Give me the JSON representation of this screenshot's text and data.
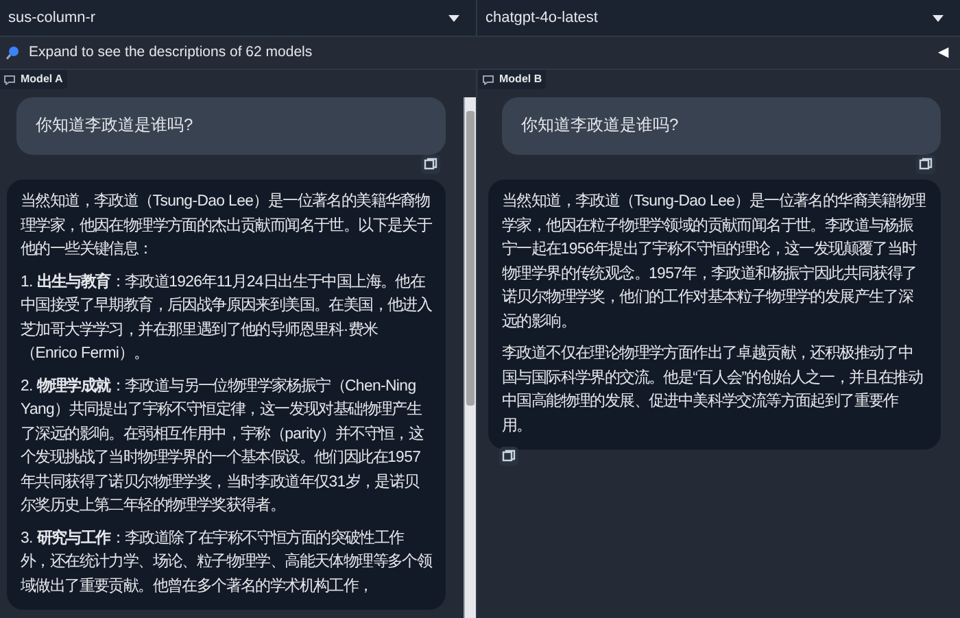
{
  "model_selectors": [
    {
      "value": "sus-column-r"
    },
    {
      "value": "chatgpt-4o-latest"
    }
  ],
  "expand_bar": {
    "label": "Expand to see the descriptions of 62 models",
    "toggle": "◀"
  },
  "panels": [
    {
      "label": "Model A",
      "question": "你知道李政道是谁吗?",
      "answer": [
        "当然知道，李政道（Tsung-Dao Lee）是一位著名的美籍华裔物理学家，他因在物理学方面的杰出贡献而闻名于世。以下是关于他的一些关键信息：",
        "1. **出生与教育**：李政道1926年11月24日出生于中国上海。他在中国接受了早期教育，后因战争原因来到美国。在美国，他进入芝加哥大学学习，并在那里遇到了他的导师恩里科·费米（Enrico Fermi）。",
        "2. **物理学成就**：李政道与另一位物理学家杨振宁（Chen-Ning Yang）共同提出了宇称不守恒定律，这一发现对基础物理产生了深远的影响。在弱相互作用中，宇称（parity）并不守恒，这个发现挑战了当时物理学界的一个基本假设。他们因此在1957年共同获得了诺贝尔物理学奖，当时李政道年仅31岁，是诺贝尔奖历史上第二年轻的物理学奖获得者。",
        "3. **研究与工作**：李政道除了在宇称不守恒方面的突破性工作外，还在统计力学、场论、粒子物理学、高能天体物理等多个领域做出了重要贡献。他曾在多个著名的学术机构工作，"
      ]
    },
    {
      "label": "Model B",
      "question": "你知道李政道是谁吗?",
      "answer": [
        "当然知道，李政道（Tsung-Dao Lee）是一位著名的华裔美籍物理学家，他因在粒子物理学领域的贡献而闻名于世。李政道与杨振宁一起在1956年提出了宇称不守恒的理论，这一发现颠覆了当时物理学界的传统观念。1957年，李政道和杨振宁因此共同获得了诺贝尔物理学奖，他们的工作对基本粒子物理学的发展产生了深远的影响。",
        "李政道不仅在理论物理学方面作出了卓越贡献，还积极推动了中国与国际科学界的交流。他是“百人会”的创始人之一，并且在推动中国高能物理的发展、促进中美科学交流等方面起到了重要作用。"
      ]
    }
  ]
}
